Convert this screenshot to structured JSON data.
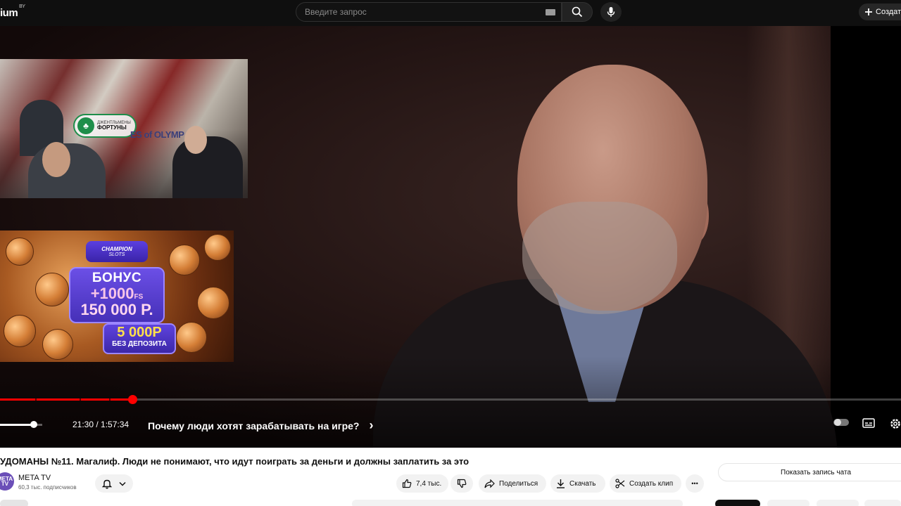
{
  "topbar": {
    "logo_text": "ium",
    "logo_sup": "BY",
    "search_placeholder": "Введите запрос",
    "create_label": "Создать"
  },
  "overlay_stream": {
    "badge_line1": "ДЖЕНТЛЬМЕНЫ",
    "badge_line2": "ФОРТУНЫ",
    "sign_text": "ES of OLYMP"
  },
  "overlay_ad": {
    "brand_line1": "CHAMPION",
    "brand_line2": "SLOTS",
    "bonus": "БОНУС",
    "fs_amount": "+1000",
    "fs_unit": "FS",
    "rub_amount": "150 000 Р.",
    "dep_amount": "5 000Р",
    "dep_text": "БЕЗ ДЕПОЗИТА"
  },
  "player": {
    "progress": 0.147,
    "volume": 0.8,
    "time": "21:30 / 1:57:34",
    "chapter_title": "Почему люди хотят зарабатывать на игре?",
    "chapter_chevron": "›"
  },
  "video": {
    "title": "УДОМАНЫ №11. Магалиф. Люди не понимают, что идут поиграть за деньги и должны заплатить за это",
    "channel_avatar": "META TV",
    "channel_name": "META TV",
    "subscribers": "60,3 тыс. подписчиков",
    "likes": "7,4 тыс.",
    "share": "Поделиться",
    "download": "Скачать",
    "clip": "Создать клип",
    "more": "•••",
    "show_chat": "Показать запись чата"
  },
  "colors": {
    "accent_red": "#ff0000",
    "bg_dark": "#0f0f0f",
    "pill_bg": "#f2f2f2"
  }
}
